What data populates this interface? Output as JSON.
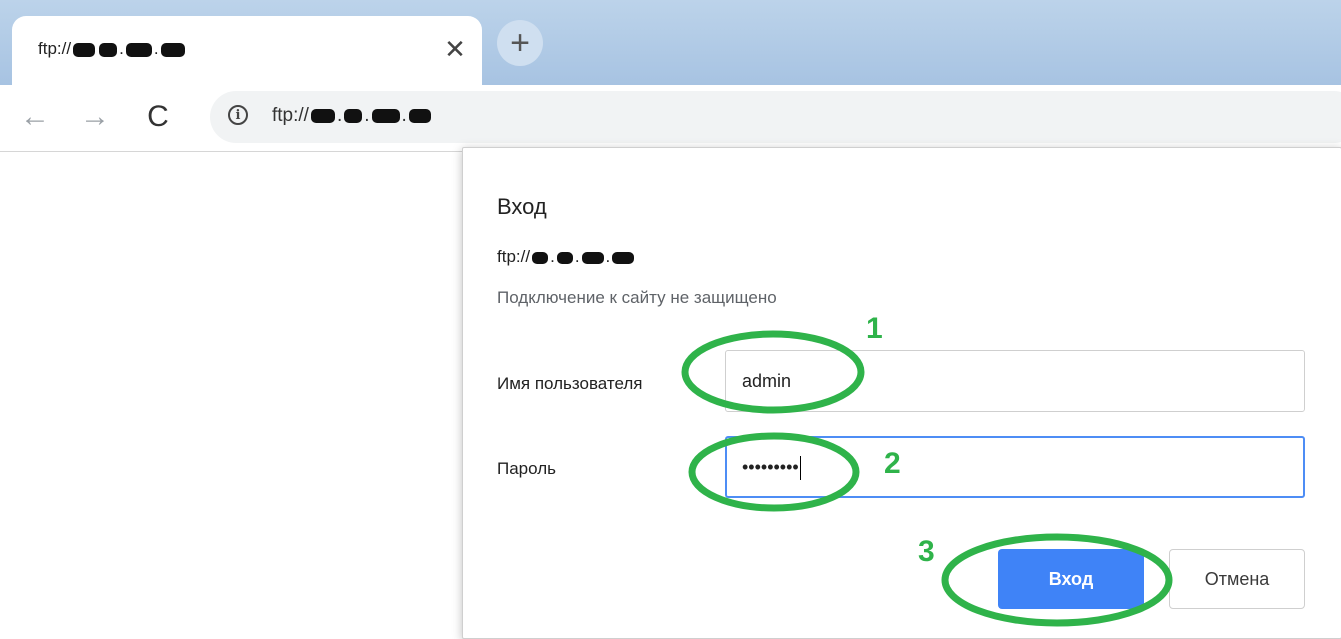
{
  "browser": {
    "tab": {
      "title_prefix": "ftp://",
      "close_icon": "close-icon",
      "close_glyph": "✕"
    },
    "new_tab_glyph": "+",
    "toolbar": {
      "back_glyph": "←",
      "forward_glyph": "→",
      "reload_glyph": "C",
      "info_glyph": "i",
      "url_prefix": "ftp://"
    }
  },
  "dialog": {
    "title": "Вход",
    "url_prefix": "ftp://",
    "warning": "Подключение к сайту не защищено",
    "username_label": "Имя пользователя",
    "username_value": "admin",
    "password_label": "Пароль",
    "password_masked": "•••••••••",
    "submit_label": "Вход",
    "cancel_label": "Отмена"
  },
  "annotations": {
    "color": "#2fb34a",
    "steps": [
      "1",
      "2",
      "3"
    ]
  }
}
